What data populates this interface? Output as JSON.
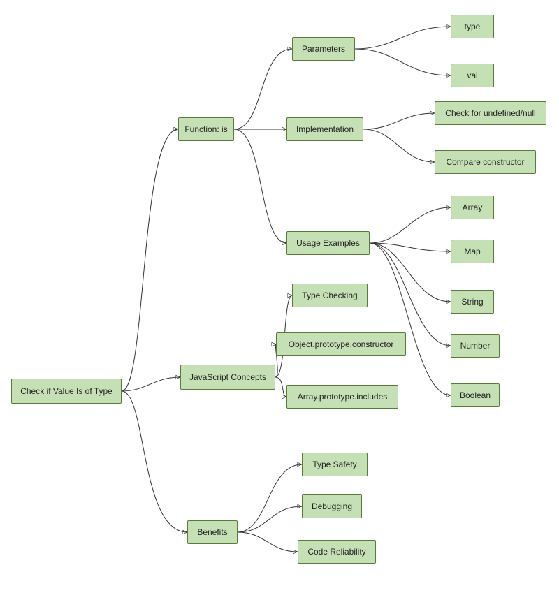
{
  "nodes": {
    "root": "Check if Value Is of Type",
    "function_is": "Function: is",
    "parameters": "Parameters",
    "p_type": "type",
    "p_val": "val",
    "implementation": "Implementation",
    "impl_undef": "Check for undefined/null",
    "impl_constructor": "Compare constructor",
    "usage": "Usage Examples",
    "usage_array": "Array",
    "usage_map": "Map",
    "usage_string": "String",
    "usage_number": "Number",
    "usage_boolean": "Boolean",
    "js_concepts": "JavaScript Concepts",
    "jc_typechecking": "Type Checking",
    "jc_constructor": "Object.prototype.constructor",
    "jc_includes": "Array.prototype.includes",
    "benefits": "Benefits",
    "b_safety": "Type Safety",
    "b_debug": "Debugging",
    "b_reliability": "Code Reliability"
  }
}
